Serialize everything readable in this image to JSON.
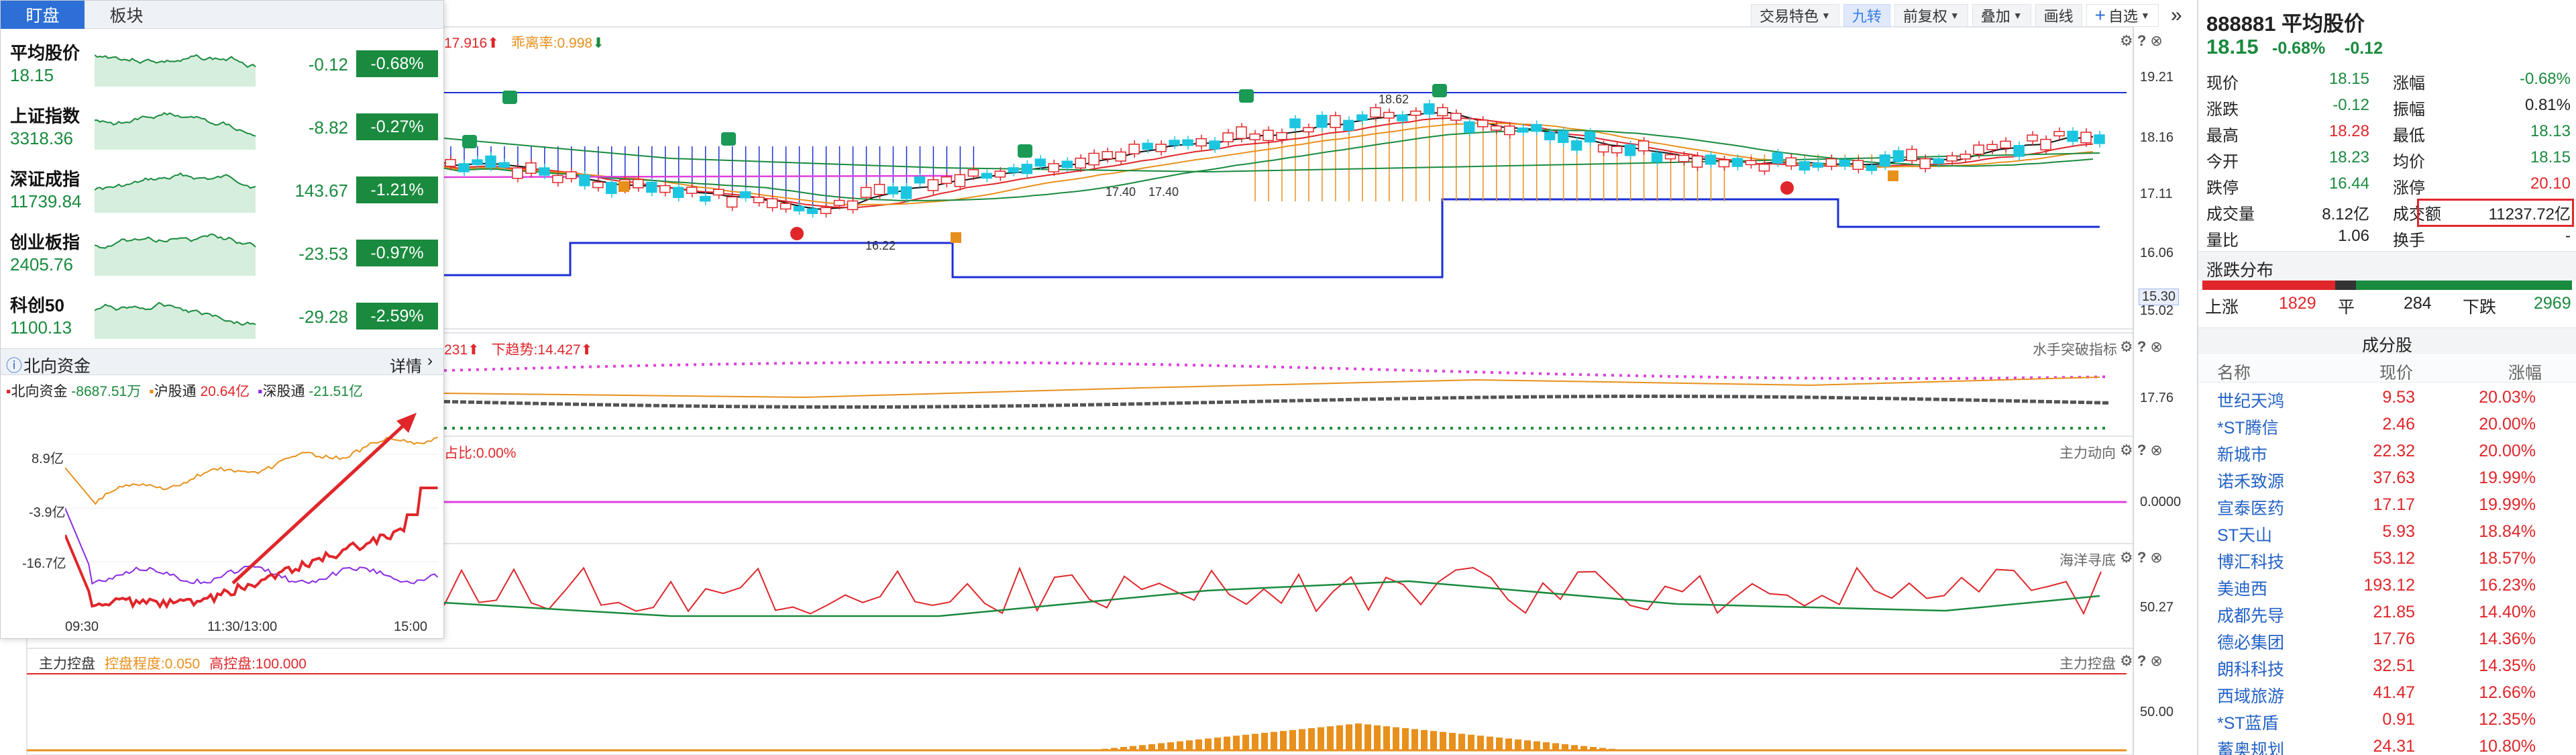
{
  "toolbar": {
    "items": [
      "交易特色",
      "九转",
      "前复权",
      "叠加",
      "画线",
      "自选"
    ],
    "add_prefix": "+",
    "more": "»"
  },
  "main_chart": {
    "legend_pre": "17.916",
    "legend_rate": "乖离率:0.998",
    "y_ticks": [
      "19.21",
      "18.16",
      "17.11",
      "16.06",
      "15.30",
      "15.02"
    ],
    "high_label": "18.62",
    "low_label": "16.22",
    "mid_labels": [
      "17.40",
      "17.40"
    ],
    "current_box": "15.30"
  },
  "indicator1": {
    "title_left": "231",
    "down_trend": "下趋势:14.427",
    "name": "水手突破指标",
    "y_tick": "17.76"
  },
  "indicator2": {
    "title_left": "占比:0.00%",
    "name": "主力动向",
    "y_tick": "0.0000"
  },
  "indicator3": {
    "name": "海洋寻底",
    "y_tick": "50.27"
  },
  "indicator4": {
    "title": "主力控盘",
    "control": "控盘程度:0.050",
    "high": "高控盘:100.000",
    "name": "主力控盘",
    "y_tick": "50.00"
  },
  "overlay": {
    "tabs": [
      "盯盘",
      "板块"
    ],
    "indices": [
      {
        "name": "平均股价",
        "price": "18.15",
        "change": "-0.12",
        "pct": "-0.68%"
      },
      {
        "name": "上证指数",
        "price": "3318.36",
        "change": "-8.82",
        "pct": "-0.27%"
      },
      {
        "name": "深证成指",
        "price": "11739.84",
        "change": "143.67",
        "pct": "-1.21%"
      },
      {
        "name": "创业板指",
        "price": "2405.76",
        "change": "-23.53",
        "pct": "-0.97%"
      },
      {
        "name": "科创50",
        "price": "1100.13",
        "change": "-29.28",
        "pct": "-2.59%"
      }
    ],
    "northbound": {
      "title": "北向资金",
      "detail": "详情",
      "legend": [
        {
          "name": "北向资金",
          "value": "-8687.51万",
          "color": "#e0262a"
        },
        {
          "name": "沪股通",
          "value": "20.64亿",
          "color": "#e8901c"
        },
        {
          "name": "深股通",
          "value": "-21.51亿",
          "color": "#8a2be2"
        }
      ],
      "y_ticks": [
        "8.9亿",
        "-3.9亿",
        "-16.7亿"
      ],
      "x_ticks": [
        "09:30",
        "11:30/13:00",
        "15:00"
      ]
    }
  },
  "right_panel": {
    "code_name": "888881 平均股价",
    "price": "18.15",
    "change": "-0.68%",
    "change_abs": "-0.12",
    "stats": [
      {
        "l": "现价",
        "v": "18.15",
        "vc": "green",
        "l2": "涨幅",
        "v2": "-0.68%",
        "v2c": "green"
      },
      {
        "l": "涨跌",
        "v": "-0.12",
        "vc": "green",
        "l2": "振幅",
        "v2": "0.81%",
        "v2c": "dark"
      },
      {
        "l": "最高",
        "v": "18.28",
        "vc": "red",
        "l2": "最低",
        "v2": "18.13",
        "v2c": "green"
      },
      {
        "l": "今开",
        "v": "18.23",
        "vc": "green",
        "l2": "均价",
        "v2": "18.15",
        "v2c": "green"
      },
      {
        "l": "跌停",
        "v": "16.44",
        "vc": "green",
        "l2": "涨停",
        "v2": "20.10",
        "v2c": "red"
      },
      {
        "l": "成交量",
        "v": "8.12亿",
        "vc": "dark",
        "l2": "成交额",
        "v2": "11237.72亿",
        "v2c": "dark"
      },
      {
        "l": "量比",
        "v": "1.06",
        "vc": "dark",
        "l2": "换手",
        "v2": "-",
        "v2c": "dark"
      }
    ],
    "dist_title": "涨跌分布",
    "up_label": "上涨",
    "up": "1829",
    "flat_label": "平",
    "flat": "284",
    "down_label": "下跌",
    "down": "2969",
    "constituents_title": "成分股",
    "cols": [
      "名称",
      "现价",
      "涨幅"
    ],
    "constituents": [
      [
        "世纪天鸿",
        "9.53",
        "20.03%"
      ],
      [
        "*ST腾信",
        "2.46",
        "20.00%"
      ],
      [
        "新城市",
        "22.32",
        "20.00%"
      ],
      [
        "诺禾致源",
        "37.63",
        "19.99%"
      ],
      [
        "宣泰医药",
        "17.17",
        "19.99%"
      ],
      [
        "ST天山",
        "5.93",
        "18.84%"
      ],
      [
        "博汇科技",
        "53.12",
        "18.57%"
      ],
      [
        "美迪西",
        "193.12",
        "16.23%"
      ],
      [
        "成都先导",
        "21.85",
        "14.40%"
      ],
      [
        "德必集团",
        "17.76",
        "14.36%"
      ],
      [
        "朗科科技",
        "32.51",
        "14.35%"
      ],
      [
        "西域旅游",
        "41.47",
        "12.66%"
      ],
      [
        "*ST蓝盾",
        "0.91",
        "12.35%"
      ],
      [
        "蓄奥规划",
        "24.31",
        "10.80%"
      ]
    ]
  },
  "colors": {
    "up": "#e0262a",
    "down": "#1a8a3e",
    "accent": "#2d6fd6",
    "orange": "#e8901c",
    "blue_line": "#1c2fd6"
  }
}
